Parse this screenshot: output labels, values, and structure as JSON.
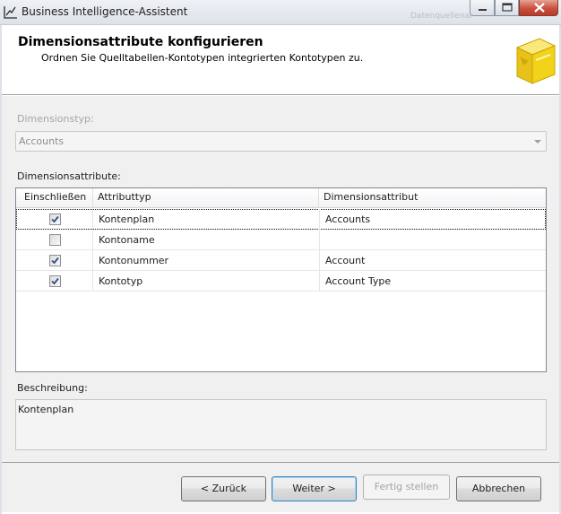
{
  "window": {
    "title": "Business Intelligence-Assistent",
    "background_title": "Datenquellenan"
  },
  "header": {
    "title": "Dimensionsattribute konfigurieren",
    "subtitle": "Ordnen Sie Quelltabellen-Kontotypen integrierten Kontotypen zu.",
    "icon": "cube-icon"
  },
  "dimension_type": {
    "label": "Dimensionstyp:",
    "value": "Accounts",
    "enabled": false
  },
  "attributes": {
    "label": "Dimensionsattribute:",
    "columns": [
      "Einschließen",
      "Attributtyp",
      "Dimensionsattribut"
    ],
    "rows": [
      {
        "include": true,
        "attribute_type": "Kontenplan",
        "dimension_attribute": "Accounts",
        "selected": true
      },
      {
        "include": false,
        "attribute_type": "Kontoname",
        "dimension_attribute": "",
        "selected": false
      },
      {
        "include": true,
        "attribute_type": "Kontonummer",
        "dimension_attribute": "Account",
        "selected": false
      },
      {
        "include": true,
        "attribute_type": "Kontotyp",
        "dimension_attribute": "Account Type",
        "selected": false
      }
    ]
  },
  "description": {
    "label": "Beschreibung:",
    "text": "Kontenplan"
  },
  "buttons": {
    "back": "< Zurück",
    "next": "Weiter >",
    "finish": "Fertig stellen",
    "cancel": "Abbrechen"
  },
  "colors": {
    "close_button": "#c9513c",
    "default_button_border": "#3c7fb1",
    "cube_yellow": "#f3d21a"
  }
}
